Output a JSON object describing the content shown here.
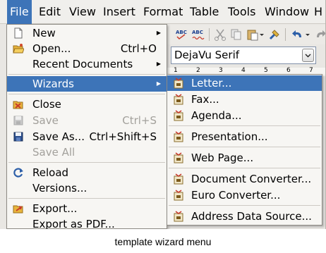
{
  "menubar": {
    "items": [
      {
        "label": "File"
      },
      {
        "label": "Edit"
      },
      {
        "label": "View"
      },
      {
        "label": "Insert"
      },
      {
        "label": "Format"
      },
      {
        "label": "Table"
      },
      {
        "label": "Tools"
      },
      {
        "label": "Window"
      },
      {
        "label": "H"
      }
    ]
  },
  "toolbar": {
    "font_name": "DejaVu Serif",
    "ruler_numbers": [
      "1",
      "2",
      "3",
      "4",
      "5",
      "6",
      "7"
    ]
  },
  "file_menu": {
    "items": [
      {
        "label": "New",
        "shortcut": "",
        "icon": "new-document-icon",
        "submenu": true,
        "disabled": false
      },
      {
        "label": "Open...",
        "shortcut": "Ctrl+O",
        "icon": "open-folder-icon",
        "submenu": false,
        "disabled": false
      },
      {
        "label": "Recent Documents",
        "shortcut": "",
        "icon": "",
        "submenu": true,
        "disabled": false
      },
      {
        "label": "Wizards",
        "shortcut": "",
        "icon": "",
        "submenu": true,
        "disabled": false,
        "highlighted": true
      },
      {
        "label": "Close",
        "shortcut": "",
        "icon": "close-document-icon",
        "submenu": false,
        "disabled": false
      },
      {
        "label": "Save",
        "shortcut": "Ctrl+S",
        "icon": "save-icon",
        "submenu": false,
        "disabled": true
      },
      {
        "label": "Save As...",
        "shortcut": "Ctrl+Shift+S",
        "icon": "save-as-icon",
        "submenu": false,
        "disabled": false
      },
      {
        "label": "Save All",
        "shortcut": "",
        "icon": "",
        "submenu": false,
        "disabled": true
      },
      {
        "label": "Reload",
        "shortcut": "",
        "icon": "reload-icon",
        "submenu": false,
        "disabled": false
      },
      {
        "label": "Versions...",
        "shortcut": "",
        "icon": "",
        "submenu": false,
        "disabled": false
      },
      {
        "label": "Export...",
        "shortcut": "",
        "icon": "export-icon",
        "submenu": false,
        "disabled": false
      },
      {
        "label": "Export as PDF...",
        "shortcut": "",
        "icon": "",
        "submenu": false,
        "disabled": false
      }
    ]
  },
  "wizards_menu": {
    "items": [
      {
        "label": "Letter...",
        "icon": "wizard-icon",
        "highlighted": true
      },
      {
        "label": "Fax...",
        "icon": "wizard-icon"
      },
      {
        "label": "Agenda...",
        "icon": "wizard-icon"
      },
      {
        "label": "Presentation...",
        "icon": "wizard-icon"
      },
      {
        "label": "Web Page...",
        "icon": "wizard-icon"
      },
      {
        "label": "Document Converter...",
        "icon": "wizard-icon"
      },
      {
        "label": "Euro Converter...",
        "icon": "wizard-icon"
      },
      {
        "label": "Address Data Source...",
        "icon": "wizard-icon"
      }
    ]
  },
  "caption": "template wizard menu",
  "colors": {
    "highlight": "#3d74b8",
    "menu_bg": "#f7f6f3",
    "disabled_text": "#a3a19c"
  }
}
